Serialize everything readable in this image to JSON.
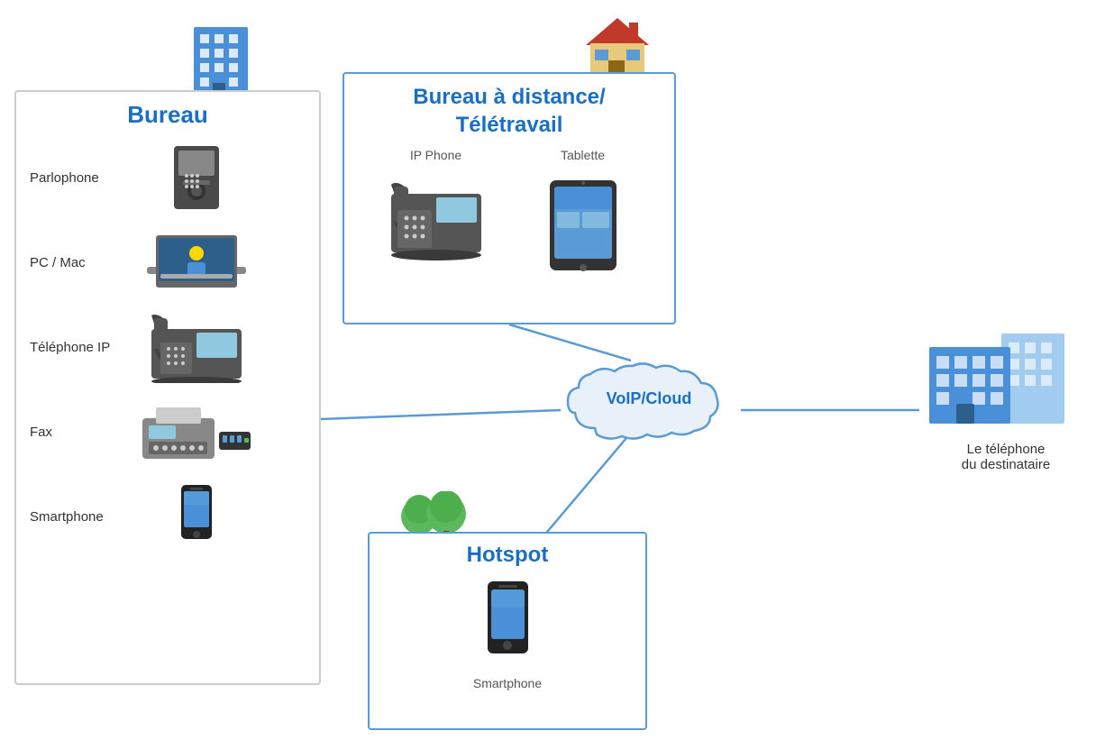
{
  "bureau": {
    "title": "Bureau",
    "items": [
      {
        "label": "Parlophone",
        "icon": "parlophone"
      },
      {
        "label": "PC / Mac",
        "icon": "pc-mac"
      },
      {
        "label": "Téléphone IP",
        "icon": "telephone-ip"
      },
      {
        "label": "Fax",
        "icon": "fax"
      },
      {
        "label": "Smartphone",
        "icon": "smartphone"
      }
    ]
  },
  "remote": {
    "title": "Bureau à distance/\nTélétravail",
    "items": [
      {
        "label": "IP Phone",
        "icon": "ip-phone"
      },
      {
        "label": "Tablette",
        "icon": "tablette"
      }
    ]
  },
  "hotspot": {
    "title": "Hotspot",
    "items": [
      {
        "label": "Smartphone",
        "icon": "smartphone-hotspot"
      }
    ]
  },
  "voip": {
    "label": "VoIP/Cloud"
  },
  "destination": {
    "label": "Le téléphone\ndu destinataire"
  },
  "colors": {
    "blue": "#1a6fc4",
    "line": "#5b9bd5"
  }
}
